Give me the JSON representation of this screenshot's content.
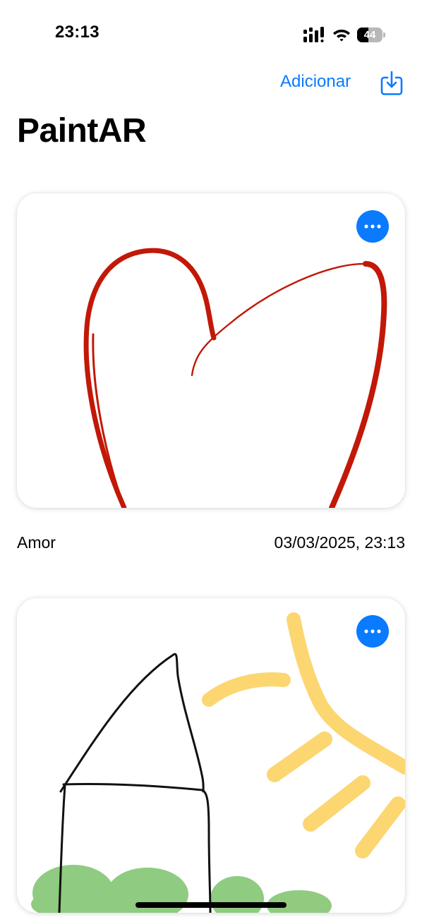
{
  "status_bar": {
    "time": "23:13",
    "battery_level": "44",
    "battery_fraction": 0.44,
    "icons": [
      "signal-icon",
      "wifi-icon",
      "battery-icon"
    ]
  },
  "nav": {
    "add_label": "Adicionar",
    "import_icon": "square-arrow-down-icon"
  },
  "page": {
    "title": "PaintAR"
  },
  "drawings": [
    {
      "name": "Amor",
      "date": "03/03/2025, 23:13",
      "menu_icon": "ellipsis-icon",
      "stroke_color": "#c21807"
    },
    {
      "menu_icon": "ellipsis-icon",
      "stroke_colors": [
        "#000000",
        "#fcd469",
        "#7cc26a"
      ]
    }
  ],
  "colors": {
    "accent": "#0a7aff",
    "background": "#ffffff"
  }
}
